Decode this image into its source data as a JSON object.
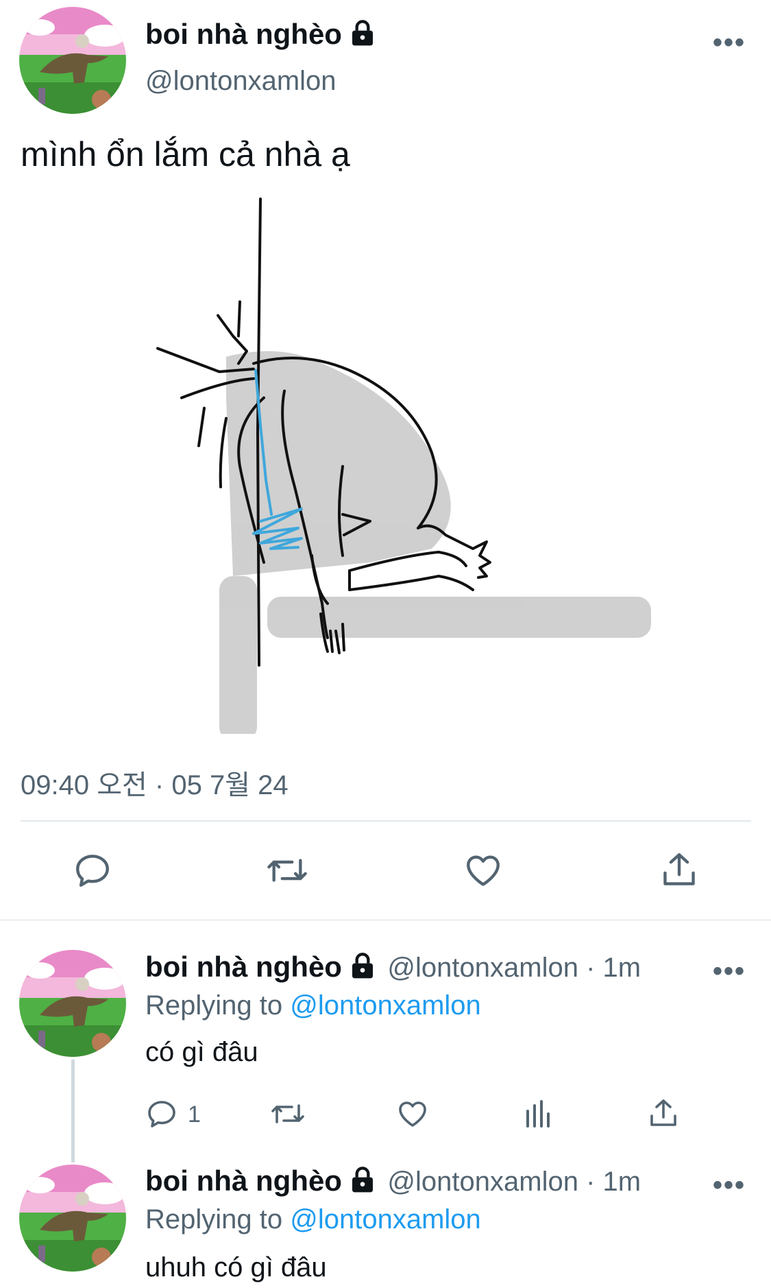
{
  "main_tweet": {
    "display_name": "boi nhà nghèo",
    "handle": "@lontonxamlon",
    "more_label": "•••",
    "text": "mình ổn lắm cả nhà ạ",
    "timestamp": "09:40 오전 · 05 7월 24",
    "actions": [
      "reply-icon",
      "retweet-icon",
      "like-icon",
      "share-icon"
    ]
  },
  "replies": [
    {
      "display_name": "boi nhà nghèo",
      "handle_time": "@lontonxamlon · 1m",
      "replying_prefix": "Replying to ",
      "replying_handle": "@lontonxamlon",
      "text": "có gì đâu",
      "reply_count": "1",
      "more_label": "•••"
    },
    {
      "display_name": "boi nhà nghèo",
      "handle_time": "@lontonxamlon · 1m",
      "replying_prefix": "Replying to ",
      "replying_handle": "@lontonxamlon",
      "text": "uhuh có gì đâu",
      "more_label": "•••"
    }
  ],
  "colors": {
    "link": "#1d9bf0",
    "secondary": "#536471",
    "divider": "#e1e8ed"
  }
}
